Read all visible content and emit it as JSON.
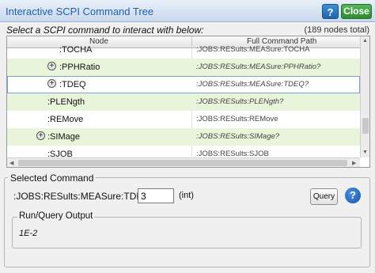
{
  "window": {
    "title": "Interactive SCPI Command Tree",
    "help_label": "?",
    "close_label": "Close"
  },
  "prompt": "Select a SCPI command to interact with below:",
  "node_count": "(189 nodes total)",
  "grid": {
    "columns": [
      "Node",
      "Full Command Path"
    ],
    "rows": [
      {
        "node": ":TOCHA",
        "path": ":JOBS:RESults:MEASure:TOCHA"
      },
      {
        "node": ":PPHRatio",
        "path": ":JOBS:RESults:MEASure:PPHRatio?"
      },
      {
        "node": ":TDEQ",
        "path": ":JOBS:RESults:MEASure:TDEQ?"
      },
      {
        "node": ":PLENgth",
        "path": ":JOBS:RESults:PLENgth?"
      },
      {
        "node": ":REMove",
        "path": ":JOBS:RESults:REMove"
      },
      {
        "node": ":SIMage",
        "path": ":JOBS:RESults:SIMage?"
      },
      {
        "node": ":SJOB",
        "path": ":JOBS:RESults:SJOB"
      }
    ],
    "scroll_up": "▲",
    "scroll_down": "▼",
    "scroll_left": "◀",
    "scroll_right": "▶"
  },
  "selected": {
    "legend": "Selected Command",
    "command": ":JOBS:RESults:MEASure:TDEQ?",
    "value": "3",
    "unit": "(int)",
    "query_label": "Query",
    "help_label": "?"
  },
  "output": {
    "legend": "Run/Query Output",
    "value": "1E-2"
  },
  "icons": {
    "expand": "plus-circle-icon",
    "help": "question-circle-icon"
  }
}
